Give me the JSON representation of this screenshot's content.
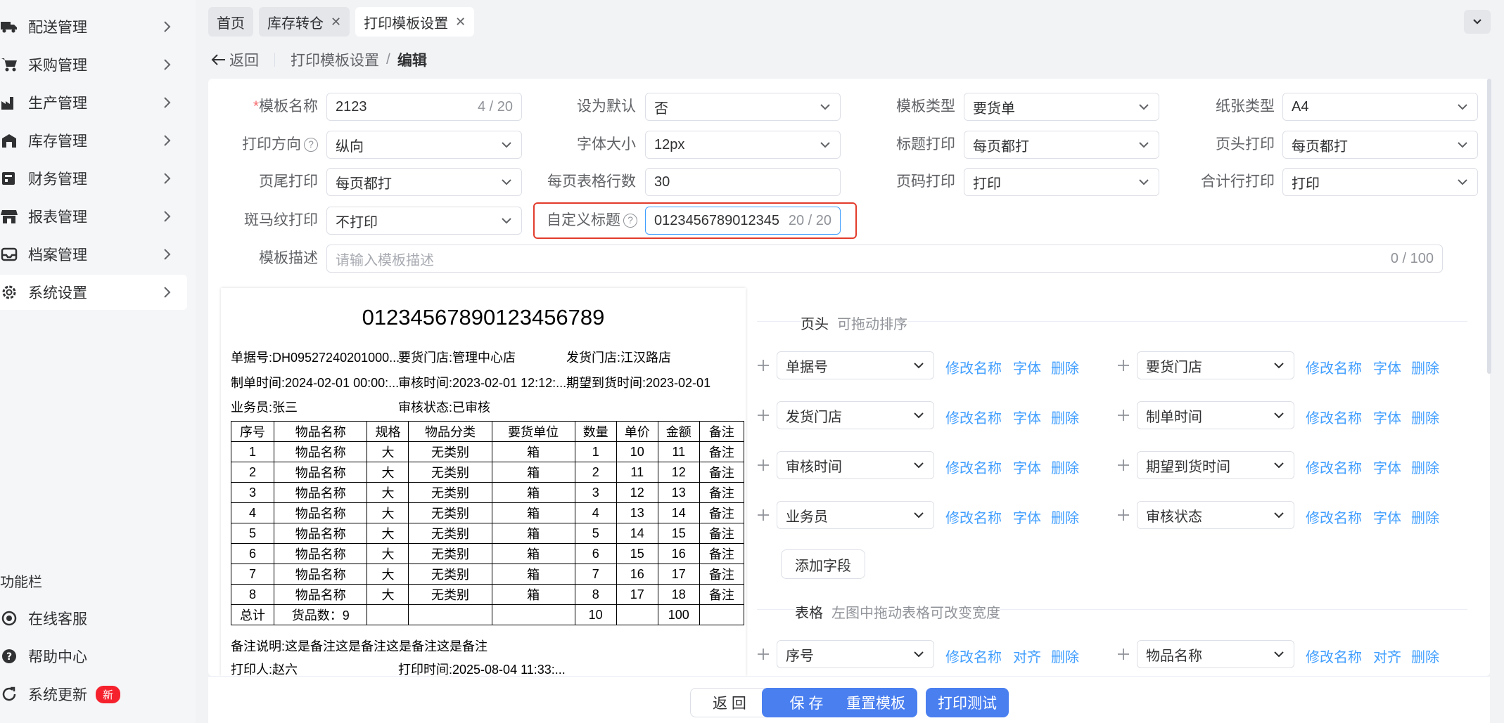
{
  "sidebar": {
    "items": [
      {
        "label": "配送管理",
        "icon": "truck-icon"
      },
      {
        "label": "采购管理",
        "icon": "cart-icon"
      },
      {
        "label": "生产管理",
        "icon": "factory-icon"
      },
      {
        "label": "库存管理",
        "icon": "warehouse-icon"
      },
      {
        "label": "财务管理",
        "icon": "finance-icon"
      },
      {
        "label": "报表管理",
        "icon": "store-icon"
      },
      {
        "label": "档案管理",
        "icon": "archive-icon"
      },
      {
        "label": "系统设置",
        "icon": "gear-icon"
      }
    ],
    "func_title": "功能栏",
    "tools": [
      {
        "label": "在线客服",
        "icon": "headset-icon"
      },
      {
        "label": "帮助中心",
        "icon": "help-icon"
      },
      {
        "label": "系统更新",
        "icon": "refresh-icon",
        "badge": "新"
      }
    ]
  },
  "tabs": [
    {
      "label": "首页"
    },
    {
      "label": "库存转仓",
      "close": "✕"
    },
    {
      "label": "打印模板设置",
      "close": "✕"
    }
  ],
  "breadcrumb": {
    "back": "返回",
    "parent": "打印模板设置",
    "current": "编辑",
    "slash": "/"
  },
  "form": {
    "template_name": {
      "label": "模板名称",
      "required": "*",
      "value": "2123",
      "count": "4 / 20"
    },
    "set_default": {
      "label": "设为默认",
      "value": "否"
    },
    "template_type": {
      "label": "模板类型",
      "value": "要货单"
    },
    "paper_type": {
      "label": "纸张类型",
      "value": "A4"
    },
    "print_direction": {
      "label": "打印方向",
      "value": "纵向"
    },
    "font_size": {
      "label": "字体大小",
      "value": "12px"
    },
    "title_print": {
      "label": "标题打印",
      "value": "每页都打"
    },
    "header_print": {
      "label": "页头打印",
      "value": "每页都打"
    },
    "footer_print": {
      "label": "页尾打印",
      "value": "每页都打"
    },
    "rows_per_page": {
      "label": "每页表格行数",
      "value": "30"
    },
    "page_number_print": {
      "label": "页码打印",
      "value": "打印"
    },
    "total_row_print": {
      "label": "合计行打印",
      "value": "打印"
    },
    "zebra_print": {
      "label": "斑马纹打印",
      "value": "不打印"
    },
    "custom_title": {
      "label": "自定义标题",
      "value": "0123456789012345",
      "count": "20 / 20"
    },
    "description": {
      "label": "模板描述",
      "placeholder": "请输入模板描述",
      "count": "0 / 100"
    }
  },
  "preview": {
    "title": "01234567890123456789",
    "lines": {
      "doc_no": "单据号:DH09527240201000...",
      "req_store": "要货门店:管理中心店",
      "ship_store": "发货门店:江汉路店",
      "make_time": "制单时间:2024-02-01 00:00:...",
      "audit_time": "审核时间:2023-02-01 12:12:...",
      "expect_time": "期望到货时间:2023-02-01",
      "salesman": "业务员:张三",
      "audit_status": "审核状态:已审核",
      "remark": "备注说明:这是备注这是备注这是备注这是备注",
      "printer": "打印人:赵六",
      "print_time": "打印时间:2025-08-04 11:33:..."
    },
    "table": {
      "headers": [
        "序号",
        "物品名称",
        "规格",
        "物品分类",
        "要货单位",
        "数量",
        "单价",
        "金额",
        "备注"
      ],
      "rows": [
        [
          "1",
          "物品名称",
          "大",
          "无类别",
          "箱",
          "1",
          "10",
          "11",
          "备注"
        ],
        [
          "2",
          "物品名称",
          "大",
          "无类别",
          "箱",
          "2",
          "11",
          "12",
          "备注"
        ],
        [
          "3",
          "物品名称",
          "大",
          "无类别",
          "箱",
          "3",
          "12",
          "13",
          "备注"
        ],
        [
          "4",
          "物品名称",
          "大",
          "无类别",
          "箱",
          "4",
          "13",
          "14",
          "备注"
        ],
        [
          "5",
          "物品名称",
          "大",
          "无类别",
          "箱",
          "5",
          "14",
          "15",
          "备注"
        ],
        [
          "6",
          "物品名称",
          "大",
          "无类别",
          "箱",
          "6",
          "15",
          "16",
          "备注"
        ],
        [
          "7",
          "物品名称",
          "大",
          "无类别",
          "箱",
          "7",
          "16",
          "17",
          "备注"
        ],
        [
          "8",
          "物品名称",
          "大",
          "无类别",
          "箱",
          "8",
          "17",
          "18",
          "备注"
        ]
      ],
      "total": {
        "label": "总计",
        "goods_count": "货品数：9",
        "qty": "10",
        "amount": "100"
      }
    }
  },
  "header_section": {
    "title": "页头",
    "hint": "可拖动排序",
    "fields": [
      {
        "value": "单据号",
        "actions": [
          "修改名称",
          "字体",
          "删除"
        ]
      },
      {
        "value": "要货门店",
        "actions": [
          "修改名称",
          "字体",
          "删除"
        ]
      },
      {
        "value": "发货门店",
        "actions": [
          "修改名称",
          "字体",
          "删除"
        ]
      },
      {
        "value": "制单时间",
        "actions": [
          "修改名称",
          "字体",
          "删除"
        ]
      },
      {
        "value": "审核时间",
        "actions": [
          "修改名称",
          "字体",
          "删除"
        ]
      },
      {
        "value": "期望到货时间",
        "actions": [
          "修改名称",
          "字体",
          "删除"
        ]
      },
      {
        "value": "业务员",
        "actions": [
          "修改名称",
          "字体",
          "删除"
        ]
      },
      {
        "value": "审核状态",
        "actions": [
          "修改名称",
          "字体",
          "删除"
        ]
      }
    ],
    "add_label": "添加字段"
  },
  "table_section": {
    "title": "表格",
    "hint": "左图中拖动表格可改变宽度",
    "fields": [
      {
        "value": "序号",
        "actions": [
          "修改名称",
          "对齐",
          "删除"
        ]
      },
      {
        "value": "物品名称",
        "actions": [
          "修改名称",
          "对齐",
          "删除"
        ]
      }
    ]
  },
  "footer_buttons": {
    "back": "返 回",
    "save": "保 存",
    "reset": "重置模板",
    "test": "打印测试"
  },
  "colors": {
    "primary": "#4a7ff0",
    "link": "#409eff",
    "highlight": "#e23b2b",
    "badge": "#f5222d"
  }
}
